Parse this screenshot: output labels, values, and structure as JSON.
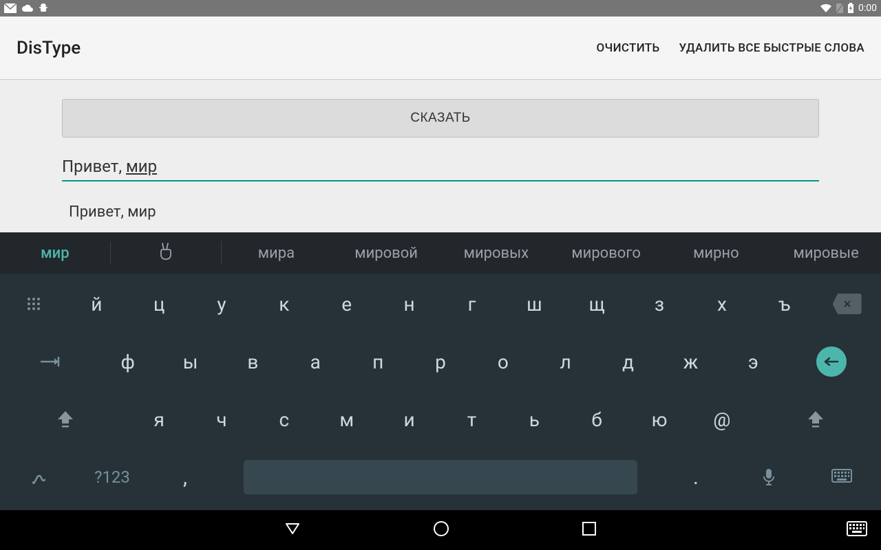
{
  "status": {
    "time": "0:00"
  },
  "appbar": {
    "title": "DisType",
    "clear": "ОЧИСТИТЬ",
    "delete_all": "УДАЛИТЬ ВСЕ БЫСТРЫЕ СЛОВА"
  },
  "main": {
    "say_button": "СКАЗАТЬ",
    "input_prefix": "Привет, ",
    "input_underlined": "мир",
    "history_line": "Привет, мир"
  },
  "suggestions": {
    "primary": "мир",
    "items": [
      "мира",
      "мировой",
      "мировых",
      "мирового",
      "мирно",
      "мировые"
    ]
  },
  "keyboard": {
    "row1": [
      "й",
      "ц",
      "у",
      "к",
      "е",
      "н",
      "г",
      "ш",
      "щ",
      "з",
      "х",
      "ъ"
    ],
    "row2": [
      "ф",
      "ы",
      "в",
      "а",
      "п",
      "р",
      "о",
      "л",
      "д",
      "ж",
      "э"
    ],
    "row3": [
      "я",
      "ч",
      "с",
      "м",
      "и",
      "т",
      "ь",
      "б",
      "ю",
      "@"
    ],
    "symkey": "?123",
    "comma": ",",
    "period": "."
  }
}
